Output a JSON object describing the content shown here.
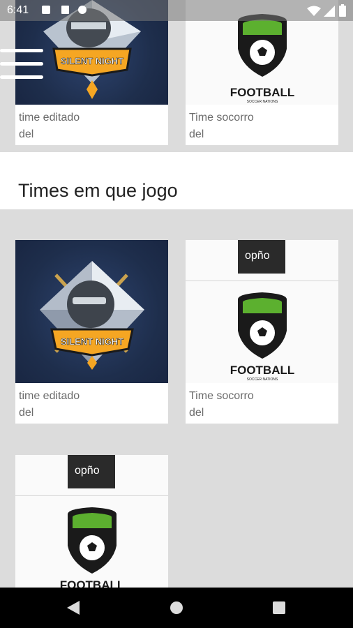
{
  "status_bar": {
    "time": "6:41"
  },
  "top_cards": [
    {
      "title": "time editado",
      "subtitle": "del",
      "logo": "silent-night"
    },
    {
      "title": "Time socorro",
      "subtitle": "del",
      "logo": "football"
    }
  ],
  "section": {
    "title": "Times em que jogo"
  },
  "cards": [
    {
      "title": "time editado",
      "subtitle": "del",
      "logo": "silent-night",
      "logo_text": "SILENT NIGHT"
    },
    {
      "title": "Time socorro",
      "subtitle": "del",
      "logo": "football",
      "logo_text": "FOOTBALL",
      "logo_subtext": "SOCCER NATIONS",
      "banner_text": "opño"
    },
    {
      "title": "",
      "subtitle": "",
      "logo": "football",
      "logo_text": "FOOTBALL",
      "banner_text": "opño"
    }
  ],
  "colors": {
    "background": "#dcdcdc",
    "card": "#ffffff",
    "dark_logo_bg": "#1f2f4e",
    "shield_green": "#5cb02f",
    "banner_orange": "#f5a623"
  },
  "icons": {
    "menu": "hamburger-icon",
    "back": "back-triangle-icon",
    "home": "home-circle-icon",
    "recents": "recents-square-icon"
  }
}
